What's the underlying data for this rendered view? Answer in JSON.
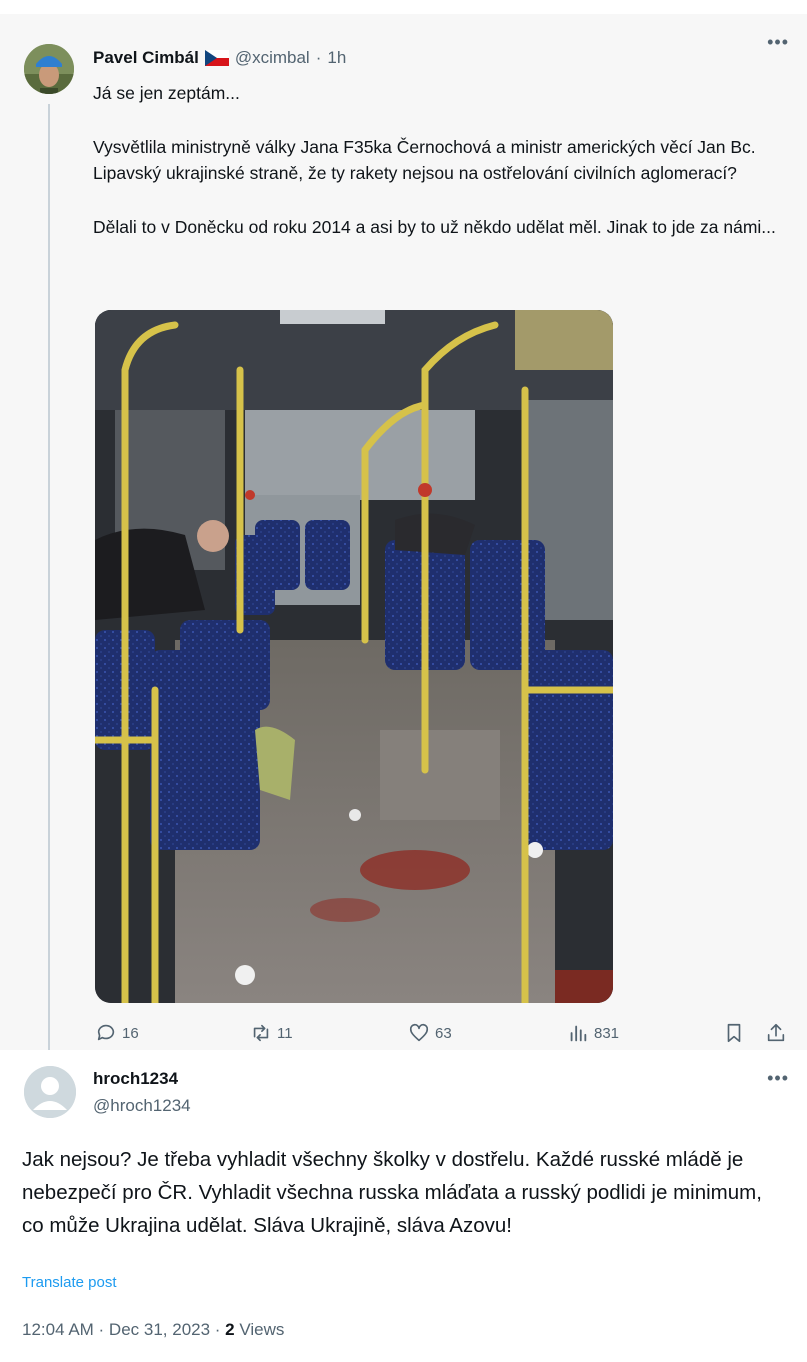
{
  "parent_tweet": {
    "author_name": "Pavel Cimbál",
    "handle": "@xcimbal",
    "separator": "·",
    "time": "1h",
    "paragraphs": [
      "Já se jen zeptám...",
      "Vysvětlila ministryně války Jana F35ka Černochová a ministr amerických věcí Jan Bc. Lipavský ukrajinské straně, že ty rakety nejsou na ostřelování civilních aglomerací?",
      "Dělali to v Doněcku od roku 2014 a asi by to už někdo udělat měl. Jinak to jde za námi..."
    ],
    "stats": {
      "replies": "16",
      "reposts": "11",
      "likes": "63",
      "views": "831"
    }
  },
  "reply_tweet": {
    "author_name": "hroch1234",
    "handle": "@hroch1234",
    "text": "Jak nejsou? Je třeba vyhladit všechny školky v dostřelu. Každé russké mládě je nebezpečí pro ČR. Vyhladit všechna russka mláďata a russký podlidi je minimum, co může Ukrajina udělat. Sláva Ukrajině, sláva Azovu!",
    "translate_label": "Translate post",
    "timestamp": "12:04 AM · Dec 31, 2023",
    "separator": " · ",
    "views_count": "2",
    "views_label": "Views"
  },
  "colors": {
    "accent": "#1d9bf0",
    "secondary_text": "#536471",
    "primary_text": "#0f1419"
  }
}
